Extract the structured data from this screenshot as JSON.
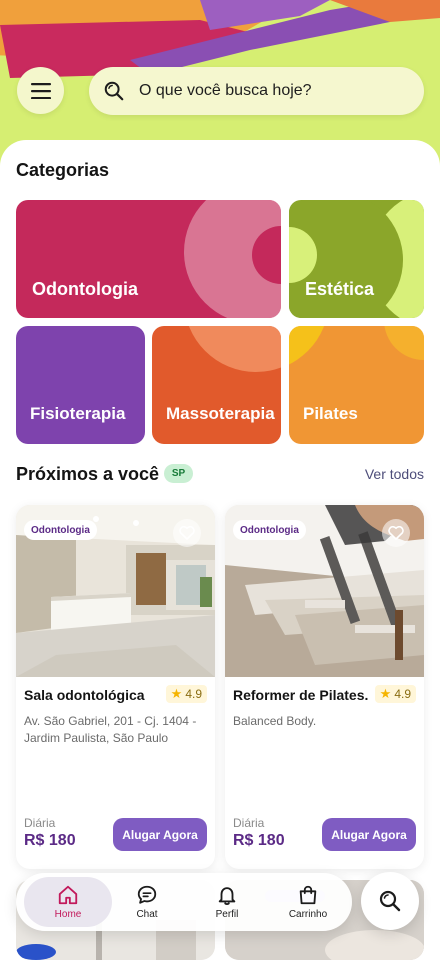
{
  "search": {
    "placeholder": "O que você busca hoje?"
  },
  "categories": {
    "title": "Categorias",
    "items": [
      {
        "label": "Odontologia",
        "color": "#c4295b"
      },
      {
        "label": "Estética",
        "color": "#8ba62a"
      },
      {
        "label": "Fisioterapia",
        "color": "#7e43ad"
      },
      {
        "label": "Massoterapia",
        "color": "#e15a2c"
      },
      {
        "label": "Pilates",
        "color": "#f09634"
      }
    ]
  },
  "nearby": {
    "title": "Próximos a você",
    "region_badge": "SP",
    "see_all": "Ver todos",
    "cards": [
      {
        "category": "Odontologia",
        "name": "Sala odontológica",
        "rating": "4.9",
        "address": "Av. São Gabriel, 201 - Cj. 1404 - Jardim Paulista, São Paulo",
        "price_label": "Diária",
        "price": "R$ 180",
        "cta": "Alugar Agora"
      },
      {
        "category": "Odontologia",
        "name": "Reformer de Pilates.",
        "rating": "4.9",
        "address": "Balanced Body.",
        "price_label": "Diária",
        "price": "R$ 180",
        "cta": "Alugar Agora"
      }
    ]
  },
  "bottom_nav": {
    "items": [
      {
        "label": "Home",
        "icon": "home-icon",
        "active": true
      },
      {
        "label": "Chat",
        "icon": "chat-icon",
        "active": false
      },
      {
        "label": "Perfil",
        "icon": "bell-icon",
        "active": false
      },
      {
        "label": "Carrinho",
        "icon": "bag-icon",
        "active": false
      }
    ],
    "fab_icon": "search-icon"
  },
  "colors": {
    "accent_purple": "#7f5cc2",
    "brand_magenta": "#c2195b",
    "hero_lime": "#d6ee72"
  }
}
